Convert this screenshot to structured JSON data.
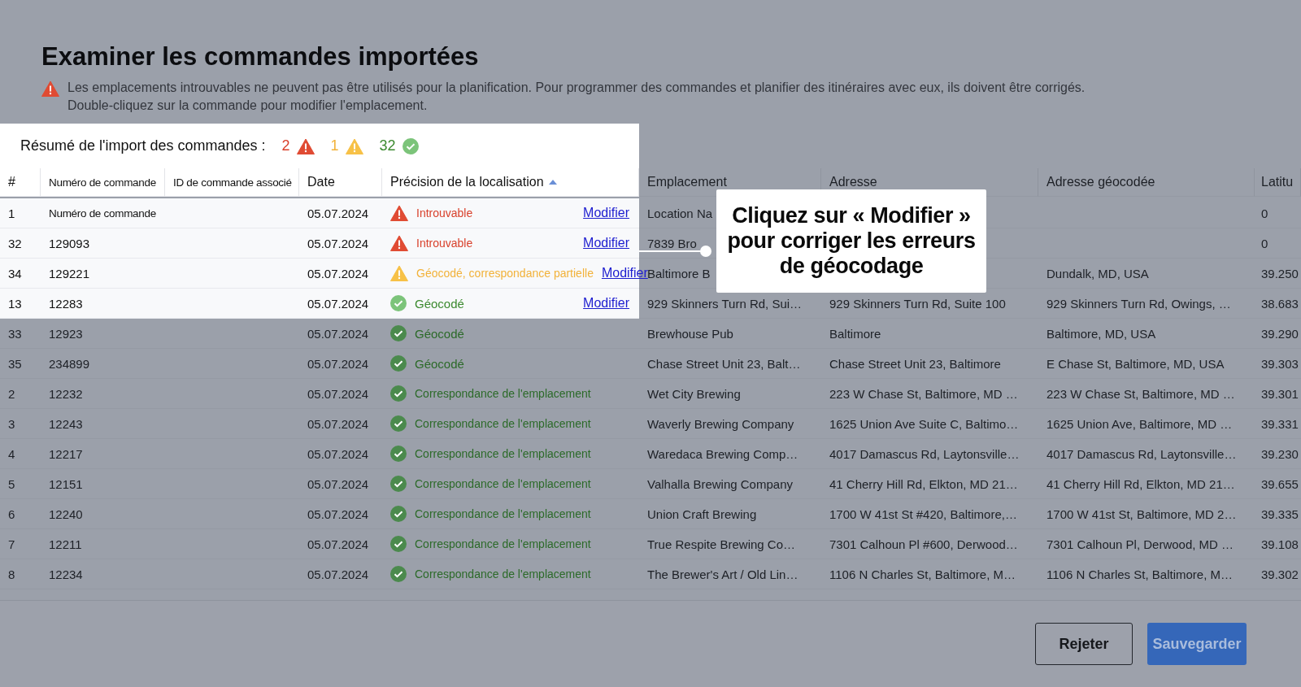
{
  "title": "Examiner les commandes importées",
  "notice": {
    "lines": [
      "Les emplacements introuvables ne peuvent pas être utilisés pour la planification. Pour programmer des commandes et planifier des itinéraires avec eux, ils doivent être corrigés.",
      "Double-cliquez sur la commande pour modifier l'emplacement."
    ]
  },
  "summary": {
    "label": "Résumé de l'import des commandes :",
    "spotlight": true,
    "counts": [
      {
        "kind": "error",
        "value": "2"
      },
      {
        "kind": "warning",
        "value": "1"
      },
      {
        "kind": "ok",
        "value": "32"
      }
    ]
  },
  "columns": [
    {
      "label": "#",
      "spotlight": true
    },
    {
      "label": "Numéro de commande",
      "spotlight": true,
      "narrow": true
    },
    {
      "label": "ID de commande associé",
      "spotlight": true,
      "narrow": true
    },
    {
      "label": "Date",
      "spotlight": true
    },
    {
      "label": "Précision de la localisation",
      "spotlight": true,
      "sorted": true
    },
    {
      "label": "Emplacement",
      "spotlight": false
    },
    {
      "label": "Adresse",
      "spotlight": false
    },
    {
      "label": "Adresse géocodée",
      "spotlight": false
    },
    {
      "label": "Latitu",
      "spotlight": false
    }
  ],
  "rows": [
    {
      "index": "1",
      "order": "Numéro de commande",
      "date": "05.07.2024",
      "status": {
        "kind": "error",
        "label": "Introuvable"
      },
      "action": "Modifier",
      "location": "Location Na",
      "latitude": "0",
      "spotlight": true
    },
    {
      "index": "32",
      "order": "129093",
      "date": "05.07.2024",
      "status": {
        "kind": "error",
        "label": "Introuvable"
      },
      "action": "Modifier",
      "location": "7839 Bro",
      "latitude": "0",
      "spotlight": true
    },
    {
      "index": "34",
      "order": "129221",
      "date": "05.07.2024",
      "status": {
        "kind": "warning",
        "label": "Géocodé, correspondance partielle"
      },
      "action": "Modifier",
      "location": "Baltimore B",
      "geocoded": "Dundalk, MD, USA",
      "latitude": "39.250",
      "spotlight": true
    },
    {
      "index": "13",
      "order": "12283",
      "date": "05.07.2024",
      "status": {
        "kind": "ok",
        "label": "Géocodé"
      },
      "action": "Modifier",
      "location": "929 Skinners Turn Rd, Sui…",
      "address": "929 Skinners Turn Rd, Suite 100",
      "geocoded": "929 Skinners Turn Rd, Owings, …",
      "latitude": "38.683",
      "spotlight": true
    },
    {
      "index": "33",
      "order": "12923",
      "date": "05.07.2024",
      "status": {
        "kind": "ok",
        "label": "Géocodé"
      },
      "location": "Brewhouse Pub",
      "address": "Baltimore",
      "geocoded": "Baltimore, MD, USA",
      "latitude": "39.290",
      "spotlight": false
    },
    {
      "index": "35",
      "order": "234899",
      "date": "05.07.2024",
      "status": {
        "kind": "ok",
        "label": "Géocodé"
      },
      "location": "Chase Street Unit 23, Balt…",
      "address": "Chase Street Unit 23, Baltimore",
      "geocoded": "E Chase St, Baltimore, MD, USA",
      "latitude": "39.303",
      "spotlight": false
    },
    {
      "index": "2",
      "order": "12232",
      "date": "05.07.2024",
      "status": {
        "kind": "ok",
        "label": "Correspondance de l'emplacement"
      },
      "location": "Wet City Brewing",
      "address": "223 W Chase St, Baltimore, MD …",
      "geocoded": "223 W Chase St, Baltimore, MD …",
      "latitude": "39.301",
      "spotlight": false
    },
    {
      "index": "3",
      "order": "12243",
      "date": "05.07.2024",
      "status": {
        "kind": "ok",
        "label": "Correspondance de l'emplacement"
      },
      "location": "Waverly Brewing Company",
      "address": "1625 Union Ave Suite C, Baltimo…",
      "geocoded": "1625 Union Ave, Baltimore, MD …",
      "latitude": "39.331",
      "spotlight": false
    },
    {
      "index": "4",
      "order": "12217",
      "date": "05.07.2024",
      "status": {
        "kind": "ok",
        "label": "Correspondance de l'emplacement"
      },
      "location": "Waredaca Brewing Comp…",
      "address": "4017 Damascus Rd, Laytonsville…",
      "geocoded": "4017 Damascus Rd, Laytonsville…",
      "latitude": "39.230",
      "spotlight": false
    },
    {
      "index": "5",
      "order": "12151",
      "date": "05.07.2024",
      "status": {
        "kind": "ok",
        "label": "Correspondance de l'emplacement"
      },
      "location": "Valhalla Brewing Company",
      "address": "41 Cherry Hill Rd, Elkton, MD 21…",
      "geocoded": "41 Cherry Hill Rd, Elkton, MD 21…",
      "latitude": "39.655",
      "spotlight": false
    },
    {
      "index": "6",
      "order": "12240",
      "date": "05.07.2024",
      "status": {
        "kind": "ok",
        "label": "Correspondance de l'emplacement"
      },
      "location": "Union Craft Brewing",
      "address": "1700 W 41st St #420, Baltimore,…",
      "geocoded": "1700 W 41st St, Baltimore, MD 2…",
      "latitude": "39.335",
      "spotlight": false
    },
    {
      "index": "7",
      "order": "12211",
      "date": "05.07.2024",
      "status": {
        "kind": "ok",
        "label": "Correspondance de l'emplacement"
      },
      "location": "True Respite Brewing Co…",
      "address": "7301 Calhoun Pl #600, Derwood…",
      "geocoded": "7301 Calhoun Pl, Derwood, MD …",
      "latitude": "39.108",
      "spotlight": false
    },
    {
      "index": "8",
      "order": "12234",
      "date": "05.07.2024",
      "status": {
        "kind": "ok",
        "label": "Correspondance de l'emplacement"
      },
      "location": "The Brewer's Art / Old Lin…",
      "address": "1106 N Charles St, Baltimore, M…",
      "geocoded": "1106 N Charles St, Baltimore, M…",
      "latitude": "39.302",
      "spotlight": false
    }
  ],
  "callout": {
    "text": "Cliquez sur « Modifier » pour corriger les erreurs de géocodage"
  },
  "buttons": [
    {
      "label": "Rejeter",
      "kind": "secondary"
    },
    {
      "label": "Sauvegarder",
      "kind": "primary"
    }
  ]
}
